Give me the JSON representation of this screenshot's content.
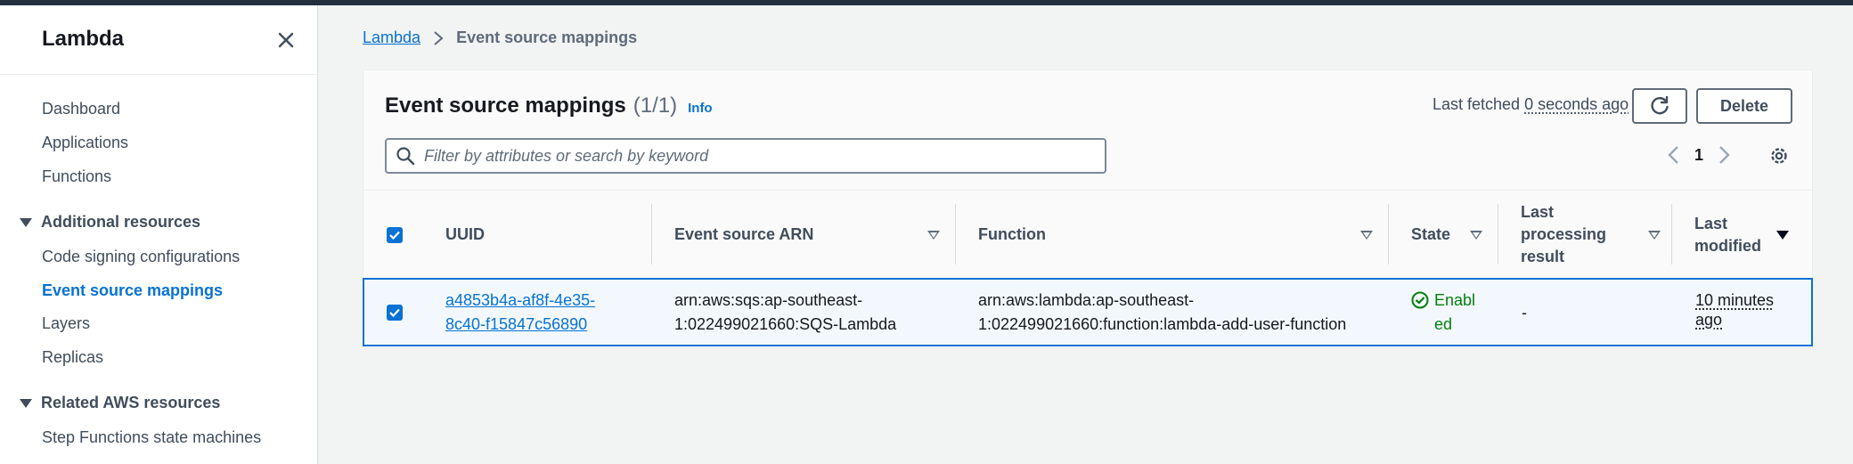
{
  "sidebar": {
    "title": "Lambda",
    "items": [
      {
        "label": "Dashboard"
      },
      {
        "label": "Applications"
      },
      {
        "label": "Functions"
      }
    ],
    "sections": [
      {
        "label": "Additional resources",
        "items": [
          {
            "label": "Code signing configurations"
          },
          {
            "label": "Event source mappings",
            "active": true
          },
          {
            "label": "Layers"
          },
          {
            "label": "Replicas"
          }
        ]
      },
      {
        "label": "Related AWS resources",
        "items": [
          {
            "label": "Step Functions state machines"
          }
        ]
      }
    ]
  },
  "breadcrumb": {
    "root": "Lambda",
    "current": "Event source mappings"
  },
  "panel": {
    "title": "Event source mappings",
    "count": "(1/1)",
    "info": "Info",
    "last_fetched_label": "Last fetched",
    "last_fetched_value": "0 seconds ago",
    "delete_label": "Delete",
    "search_placeholder": "Filter by attributes or search by keyword",
    "page": "1"
  },
  "table": {
    "columns": [
      {
        "label": "UUID"
      },
      {
        "label": "Event source ARN"
      },
      {
        "label": "Function"
      },
      {
        "label": "State"
      },
      {
        "label": "Last processing result"
      },
      {
        "label": "Last modified"
      }
    ],
    "rows": [
      {
        "selected": true,
        "uuid": "a4853b4a-af8f-4e35-8c40-f15847c56890",
        "event_source_arn": "arn:aws:sqs:ap-southeast-1:022499021660:SQS-Lambda",
        "function": "arn:aws:lambda:ap-southeast-1:022499021660:function:lambda-add-user-function",
        "state": "Enabled",
        "last_processing_result": "-",
        "last_modified": "10 minutes ago"
      }
    ]
  },
  "colors": {
    "accent": "#0972d3",
    "success": "#037f0c",
    "topbar": "#232f3e"
  },
  "icons": [
    "close-icon",
    "chevron-right-icon",
    "refresh-icon",
    "search-icon",
    "chevron-left-icon",
    "gear-icon",
    "check-icon",
    "status-success-icon"
  ]
}
